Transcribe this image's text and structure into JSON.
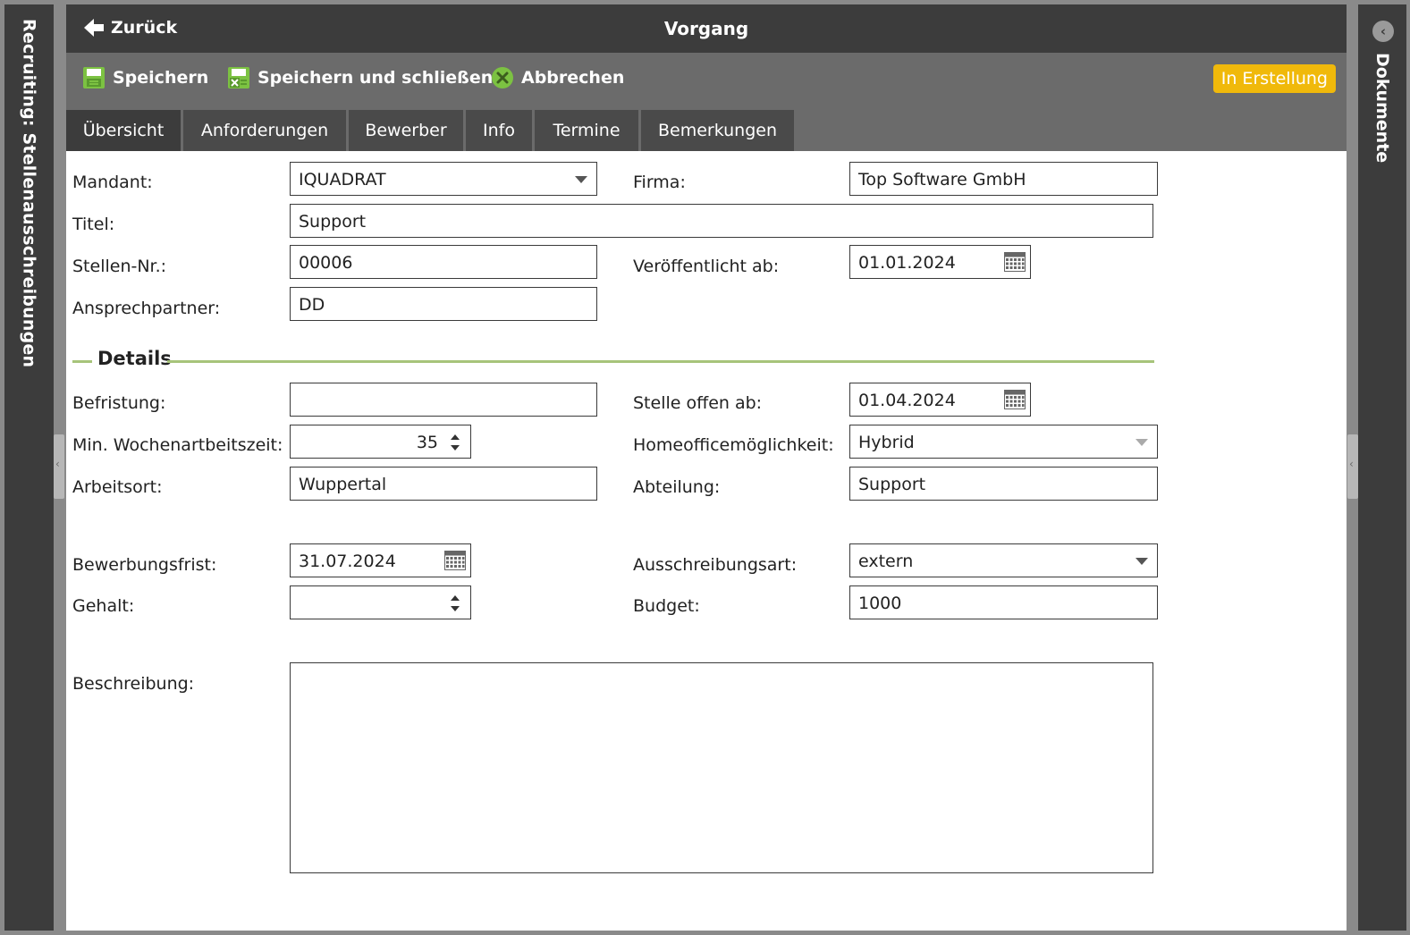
{
  "left_panel": {
    "title": "Recruiting: Stellenausschreibungen"
  },
  "right_panel": {
    "title": "Dokumente"
  },
  "titlebar": {
    "back_label": "Zurück",
    "title": "Vorgang"
  },
  "toolbar": {
    "save_label": "Speichern",
    "save_close_label": "Speichern und schließen",
    "cancel_label": "Abbrechen",
    "status": "In Erstellung"
  },
  "tabs": [
    "Übersicht",
    "Anforderungen",
    "Bewerber",
    "Info",
    "Termine",
    "Bemerkungen"
  ],
  "form": {
    "mandant": {
      "label": "Mandant:",
      "value": "IQUADRAT"
    },
    "firma": {
      "label": "Firma:",
      "value": "Top Software GmbH"
    },
    "titel": {
      "label": "Titel:",
      "value": "Support"
    },
    "stellen_nr": {
      "label": "Stellen-Nr.:",
      "value": "00006"
    },
    "veroeffentlicht_ab": {
      "label": "Veröffentlicht ab:",
      "value": "01.01.2024"
    },
    "ansprechpartner": {
      "label": "Ansprechpartner:",
      "value": "DD"
    },
    "details_title": "Details",
    "befristung": {
      "label": "Befristung:",
      "value": ""
    },
    "stelle_offen_ab": {
      "label": "Stelle offen ab:",
      "value": "01.04.2024"
    },
    "wochenarbeitszeit": {
      "label": "Min. Wochenartbeitszeit:",
      "value": "35"
    },
    "homeoffice": {
      "label": "Homeofficemöglichkeit:",
      "value": "Hybrid"
    },
    "arbeitsort": {
      "label": "Arbeitsort:",
      "value": "Wuppertal"
    },
    "abteilung": {
      "label": "Abteilung:",
      "value": "Support"
    },
    "bewerbungsfrist": {
      "label": "Bewerbungsfrist:",
      "value": "31.07.2024"
    },
    "ausschreibungsart": {
      "label": "Ausschreibungsart:",
      "value": "extern"
    },
    "gehalt": {
      "label": "Gehalt:",
      "value": ""
    },
    "budget": {
      "label": "Budget:",
      "value": "1000"
    },
    "beschreibung": {
      "label": "Beschreibung:",
      "value": ""
    }
  },
  "colors": {
    "dark_bar": "#3c3c3c",
    "toolbar": "#6b6b6b",
    "status_badge": "#f0b90b",
    "section_line": "#a7c47a",
    "icon_green": "#7cc242"
  }
}
